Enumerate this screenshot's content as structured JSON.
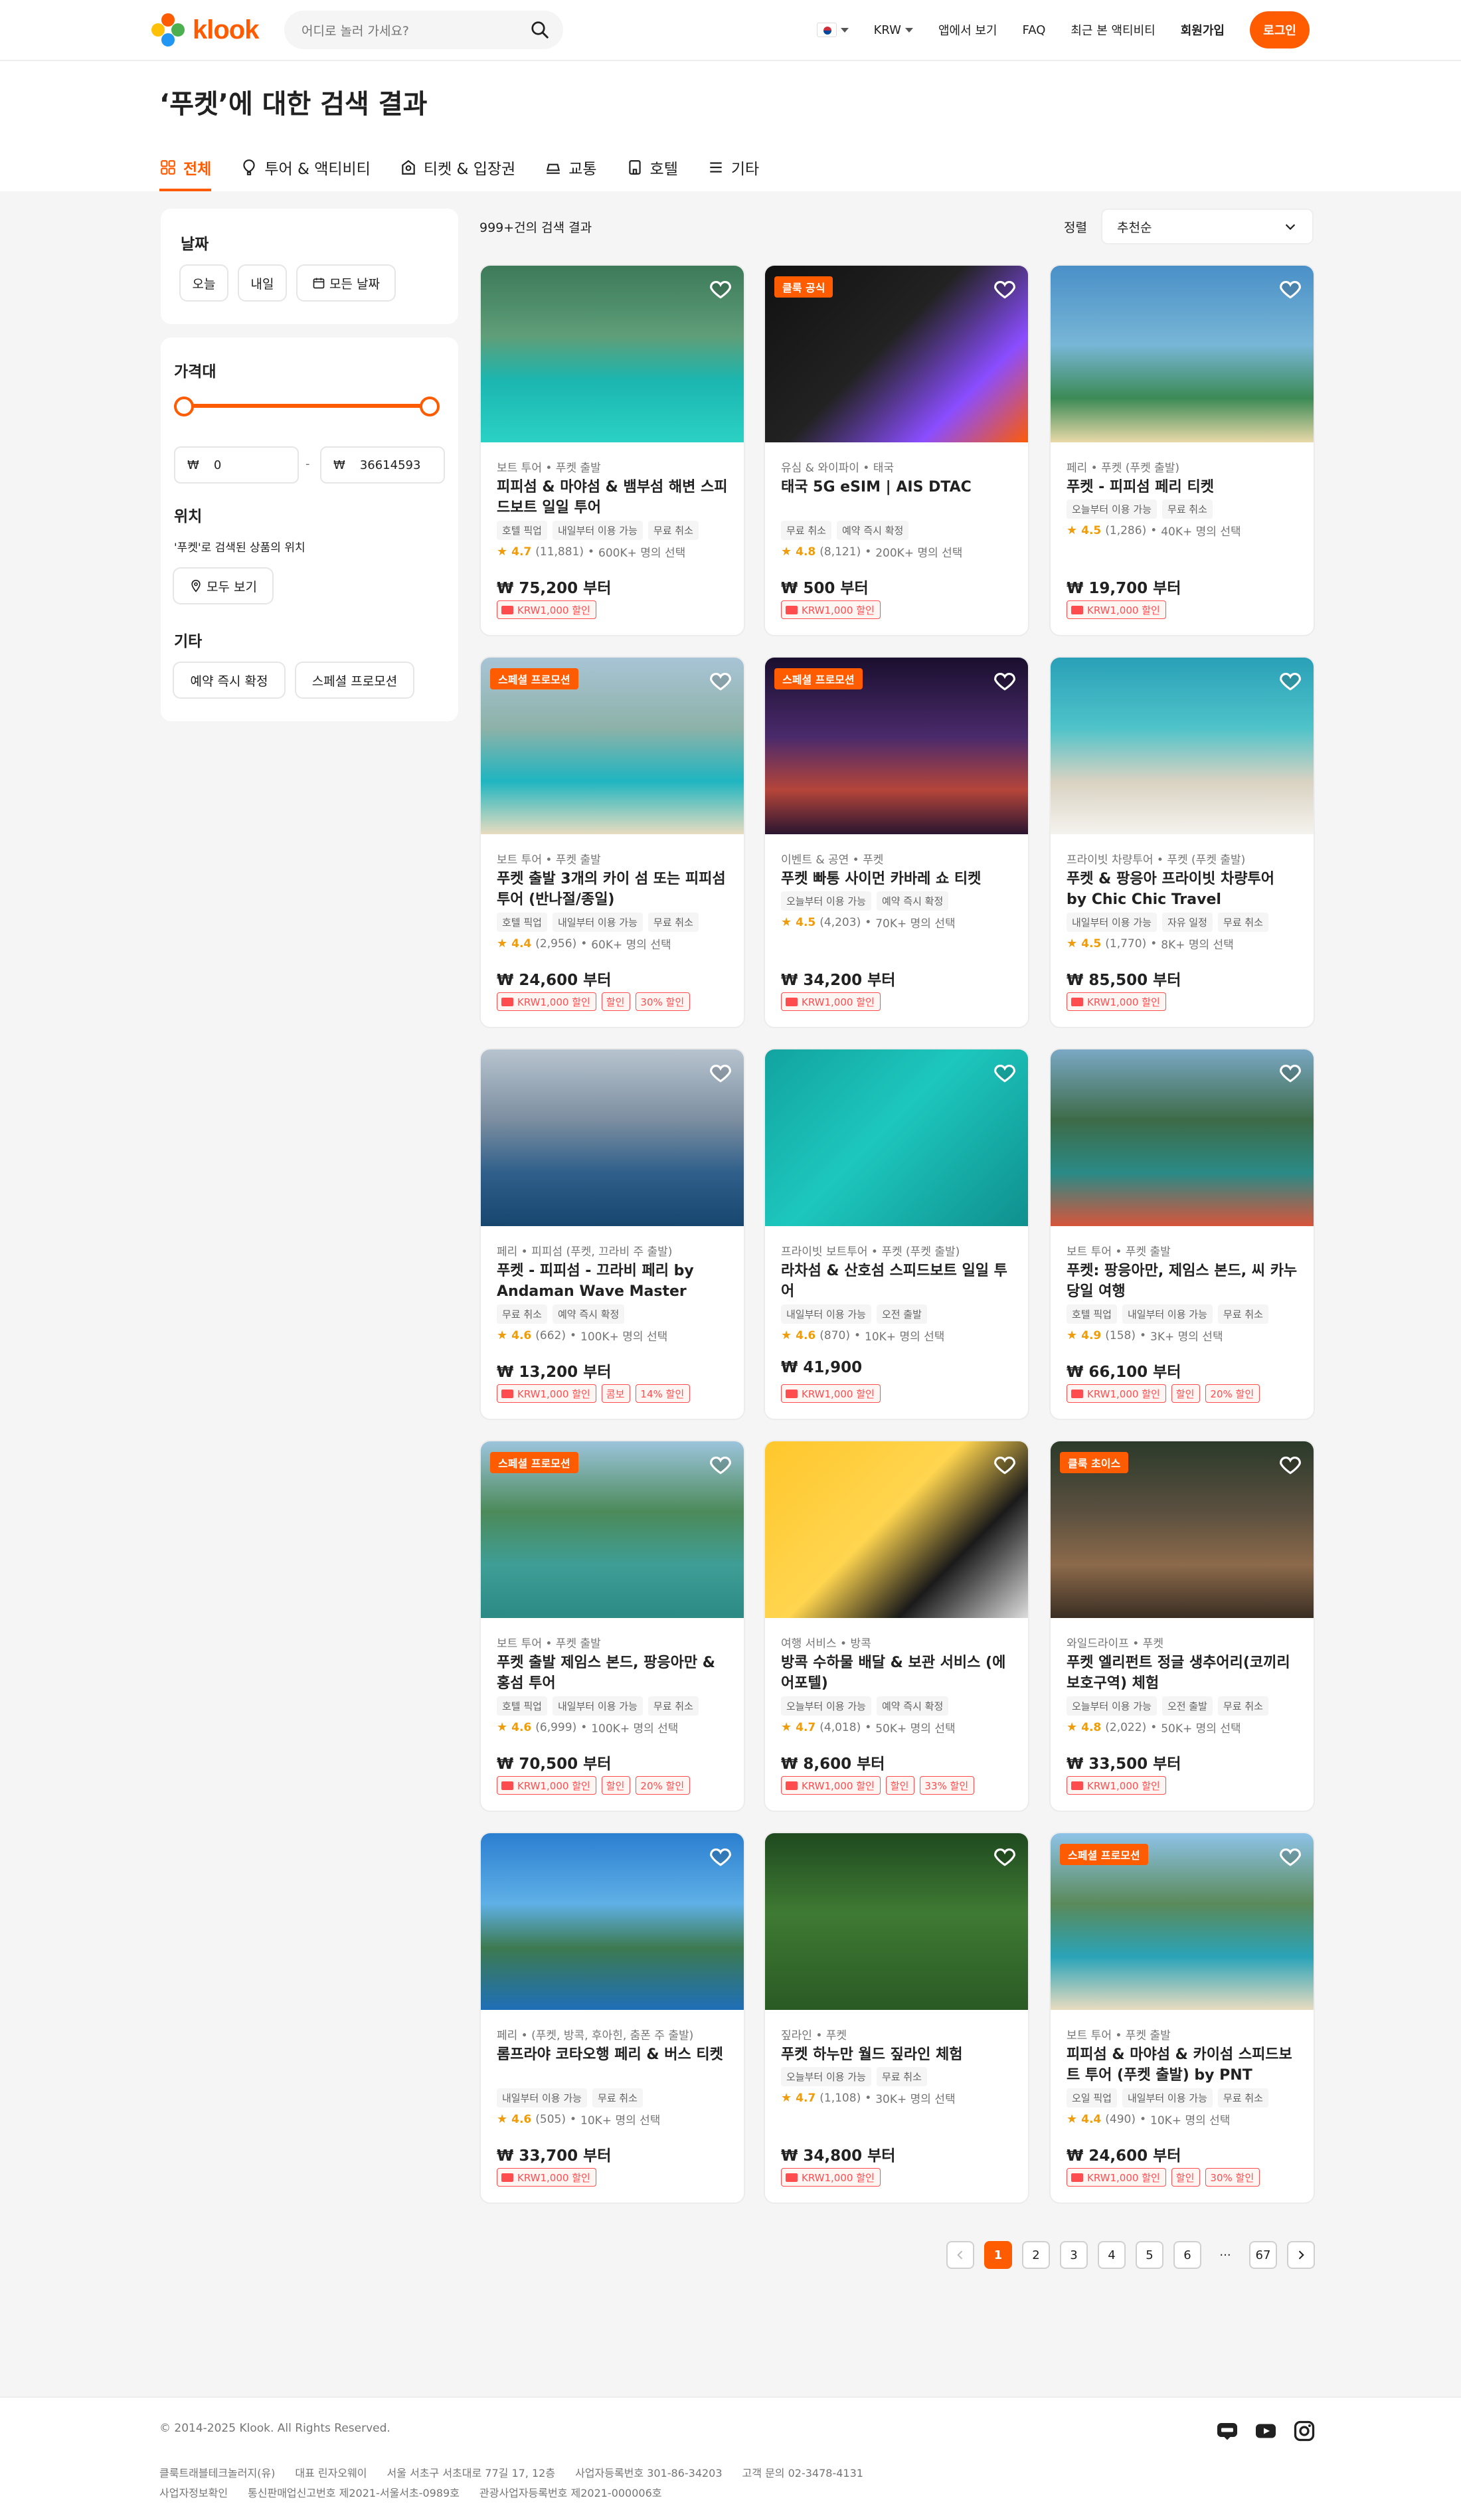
{
  "header": {
    "logo_text": "klook",
    "search_placeholder": "어디로 놀러 가세요?",
    "currency": "KRW",
    "nav": [
      "앱에서 보기",
      "FAQ",
      "최근 본 액티비티",
      "회원가입"
    ],
    "login": "로그인"
  },
  "page": {
    "title": "‘푸켓’에 대한 검색 결과",
    "tabs": [
      "전체",
      "투어 & 액티비티",
      "티켓 & 입장권",
      "교통",
      "호텔",
      "기타"
    ]
  },
  "filters": {
    "date_title": "날짜",
    "date_chips": [
      "오늘",
      "내일",
      "모든 날짜"
    ],
    "price_title": "가격대",
    "price_currency": "₩",
    "price_min": "0",
    "price_sep": "-",
    "price_max": "36614593",
    "location_title": "위치",
    "location_desc": "'푸켓'로 검색된 상품의 위치",
    "location_btn": "모두 보기",
    "other_title": "기타",
    "other_chips": [
      "예약 즉시 확정",
      "스페셜 프로모션"
    ]
  },
  "results": {
    "count": "999+건의 검색 결과",
    "sort_label": "정렬",
    "sort_value": "추천순"
  },
  "cards": [
    {
      "badge": "",
      "cat": "보트 투어 • 푸켓 출발",
      "title": "피피섬 & 마야섬 & 뱀부섬 해변 스피드보트 일일 투어",
      "tags": [
        "호텔 픽업",
        "내일부터 이용 가능",
        "무료 취소"
      ],
      "score": "4.7",
      "reviews": "(11,881)",
      "booked": "600K+ 명의 선택",
      "price": "₩ 75,200 부터",
      "promos": [
        "KRW1,000 할인"
      ]
    },
    {
      "badge": "클룩 공식",
      "cat": "유심 & 와이파이 • 태국",
      "title": "태국 5G eSIM | AIS DTAC",
      "tags": [
        "무료 취소",
        "예약 즉시 확정"
      ],
      "score": "4.8",
      "reviews": "(8,121)",
      "booked": "200K+ 명의 선택",
      "price": "₩ 500 부터",
      "promos": [
        "KRW1,000 할인"
      ]
    },
    {
      "badge": "",
      "cat": "페리 • 푸켓 (푸켓 출발)",
      "title": "푸켓 - 피피섬 페리 티켓",
      "tags": [
        "오늘부터 이용 가능",
        "무료 취소"
      ],
      "score": "4.5",
      "reviews": "(1,286)",
      "booked": "40K+ 명의 선택",
      "price": "₩ 19,700 부터",
      "promos": [
        "KRW1,000 할인"
      ]
    },
    {
      "badge": "스페셜 프로모션",
      "cat": "보트 투어 • 푸켓 출발",
      "title": "푸켓 출발 3개의 카이 섬 또는 피피섬 투어 (반나절/종일)",
      "tags": [
        "호텔 픽업",
        "내일부터 이용 가능",
        "무료 취소"
      ],
      "score": "4.4",
      "reviews": "(2,956)",
      "booked": "60K+ 명의 선택",
      "price": "₩ 24,600 부터",
      "promos": [
        "KRW1,000 할인",
        "할인",
        "30% 할인"
      ]
    },
    {
      "badge": "스페셜 프로모션",
      "cat": "이벤트 & 공연 • 푸켓",
      "title": "푸켓 빠통 사이먼 카바레 쇼 티켓",
      "tags": [
        "오늘부터 이용 가능",
        "예약 즉시 확정"
      ],
      "score": "4.5",
      "reviews": "(4,203)",
      "booked": "70K+ 명의 선택",
      "price": "₩ 34,200 부터",
      "promos": [
        "KRW1,000 할인"
      ]
    },
    {
      "badge": "",
      "cat": "프라이빗 차량투어 • 푸켓 (푸켓 출발)",
      "title": "푸켓 & 팡응아 프라이빗 차량투어 by Chic Chic Travel",
      "tags": [
        "내일부터 이용 가능",
        "자유 일정",
        "무료 취소"
      ],
      "score": "4.5",
      "reviews": "(1,770)",
      "booked": "8K+ 명의 선택",
      "price": "₩ 85,500 부터",
      "promos": [
        "KRW1,000 할인"
      ]
    },
    {
      "badge": "",
      "cat": "페리 • 피피섬 (푸켓, 끄라비 주 출발)",
      "title": "푸켓 - 피피섬 - 끄라비 페리 by Andaman Wave Master",
      "tags": [
        "무료 취소",
        "예약 즉시 확정"
      ],
      "score": "4.6",
      "reviews": "(662)",
      "booked": "100K+ 명의 선택",
      "price": "₩ 13,200 부터",
      "promos": [
        "KRW1,000 할인",
        "콤보",
        "14% 할인"
      ]
    },
    {
      "badge": "",
      "cat": "프라이빗 보트투어 • 푸켓 (푸켓 출발)",
      "title": "라차섬 & 산호섬 스피드보트 일일 투어",
      "tags": [
        "내일부터 이용 가능",
        "오전 출발"
      ],
      "score": "4.6",
      "reviews": "(870)",
      "booked": "10K+ 명의 선택",
      "price": "₩ 41,900",
      "promos": [
        "KRW1,000 할인"
      ]
    },
    {
      "badge": "",
      "cat": "보트 투어 • 푸켓 출발",
      "title": "푸켓: 팡응아만, 제임스 본드, 씨 카누 당일 여행",
      "tags": [
        "호텔 픽업",
        "내일부터 이용 가능",
        "무료 취소"
      ],
      "score": "4.9",
      "reviews": "(158)",
      "booked": "3K+ 명의 선택",
      "price": "₩ 66,100 부터",
      "promos": [
        "KRW1,000 할인",
        "할인",
        "20% 할인"
      ]
    },
    {
      "badge": "스페셜 프로모션",
      "cat": "보트 투어 • 푸켓 출발",
      "title": "푸켓 출발 제임스 본드, 팡응아만 & 홍섬 투어",
      "tags": [
        "호텔 픽업",
        "내일부터 이용 가능",
        "무료 취소"
      ],
      "score": "4.6",
      "reviews": "(6,999)",
      "booked": "100K+ 명의 선택",
      "price": "₩ 70,500 부터",
      "promos": [
        "KRW1,000 할인",
        "할인",
        "20% 할인"
      ]
    },
    {
      "badge": "",
      "cat": "여행 서비스 • 방콕",
      "title": "방콕 수하물 배달 & 보관 서비스 (에어포텔)",
      "tags": [
        "오늘부터 이용 가능",
        "예약 즉시 확정"
      ],
      "score": "4.7",
      "reviews": "(4,018)",
      "booked": "50K+ 명의 선택",
      "price": "₩ 8,600 부터",
      "promos": [
        "KRW1,000 할인",
        "할인",
        "33% 할인"
      ]
    },
    {
      "badge": "클룩 초이스",
      "cat": "와일드라이프 • 푸켓",
      "title": "푸켓 엘리펀트 정글 생추어리(코끼리 보호구역) 체험",
      "tags": [
        "오늘부터 이용 가능",
        "오전 출발",
        "무료 취소"
      ],
      "score": "4.8",
      "reviews": "(2,022)",
      "booked": "50K+ 명의 선택",
      "price": "₩ 33,500 부터",
      "promos": [
        "KRW1,000 할인"
      ]
    },
    {
      "badge": "",
      "cat": "페리 • (푸켓, 방콕, 후아힌, 춤폰 주 출발)",
      "title": "롬프라야 코타오행 페리 & 버스 티켓",
      "tags": [
        "내일부터 이용 가능",
        "무료 취소"
      ],
      "score": "4.6",
      "reviews": "(505)",
      "booked": "10K+ 명의 선택",
      "price": "₩ 33,700 부터",
      "promos": [
        "KRW1,000 할인"
      ]
    },
    {
      "badge": "",
      "cat": "짚라인 • 푸켓",
      "title": "푸켓 하누만 월드 짚라인 체험",
      "tags": [
        "오늘부터 이용 가능",
        "무료 취소"
      ],
      "score": "4.7",
      "reviews": "(1,108)",
      "booked": "30K+ 명의 선택",
      "price": "₩ 34,800 부터",
      "promos": [
        "KRW1,000 할인"
      ]
    },
    {
      "badge": "스페셜 프로모션",
      "cat": "보트 투어 • 푸켓 출발",
      "title": "피피섬 & 마야섬 & 카이섬 스피드보트 투어 (푸켓 출발) by PNT",
      "tags": [
        "오일 픽업",
        "내일부터 이용 가능",
        "무료 취소"
      ],
      "score": "4.4",
      "reviews": "(490)",
      "booked": "10K+ 명의 선택",
      "price": "₩ 24,600 부터",
      "promos": [
        "KRW1,000 할인",
        "할인",
        "30% 할인"
      ]
    }
  ],
  "pagination": {
    "pages": [
      "1",
      "2",
      "3",
      "4",
      "5",
      "6"
    ],
    "ellipsis": "···",
    "last": "67",
    "current": 1
  },
  "footer": {
    "copyright": "© 2014-2025 Klook. All Rights Reserved.",
    "line1": [
      "클룩트래블테크놀러지(유)",
      "대표 린자오웨이",
      "서울 서초구 서초대로 77길 17, 12층",
      "사업자등록번호 301-86-34203",
      "고객 문의 02-3478-4131"
    ],
    "line2": [
      "사업자정보확인",
      "통신판매업신고번호 제2021-서울서초-0989호",
      "관광사업자등록번호 제2021-000006호"
    ]
  },
  "colors": {
    "brand": "#ff5b00",
    "rating": "#f09b0a",
    "promo": "#ff4d4f"
  }
}
